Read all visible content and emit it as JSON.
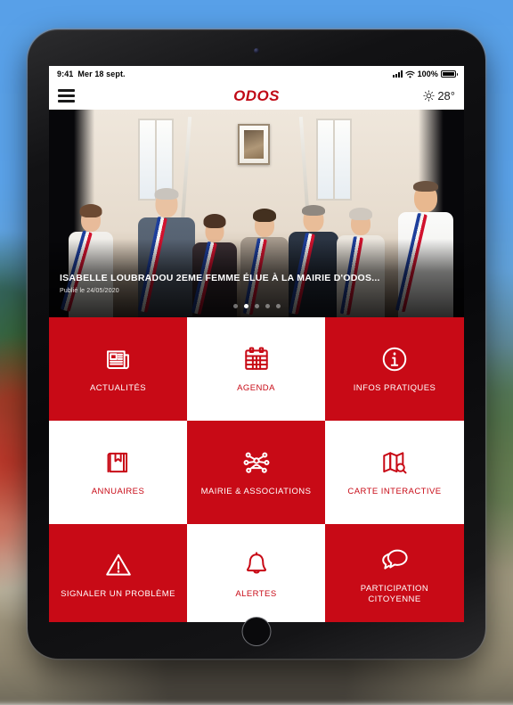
{
  "status_bar": {
    "time": "9:41",
    "date": "Mer 18 sept.",
    "battery_percent": "100%",
    "signal_icon": "cellular-signal-icon",
    "wifi_icon": "wifi-icon",
    "battery_icon": "battery-icon"
  },
  "header": {
    "menu_icon": "hamburger-menu-icon",
    "brand": "ODOS",
    "weather_icon": "sun-icon",
    "temperature": "28°"
  },
  "hero": {
    "title": "ISABELLE LOUBRADOU 2EME FEMME ÉLUE À LA MAIRIE D'ODOS...",
    "date": "Publié le 24/05/2020",
    "slide_count": 5,
    "active_slide": 2,
    "image_description": "Groupe d'élus municipaux portant des écharpes tricolores"
  },
  "tiles": [
    {
      "label": "ACTUALITÉS",
      "icon": "newspaper-icon",
      "style": "red"
    },
    {
      "label": "AGENDA",
      "icon": "calendar-icon",
      "style": "white"
    },
    {
      "label": "INFOS PRATIQUES",
      "icon": "info-circle-icon",
      "style": "red"
    },
    {
      "label": "ANNUAIRES",
      "icon": "book-bookmark-icon",
      "style": "white"
    },
    {
      "label": "MAIRIE & ASSOCIATIONS",
      "icon": "network-people-icon",
      "style": "red"
    },
    {
      "label": "CARTE INTERACTIVE",
      "icon": "map-search-icon",
      "style": "white"
    },
    {
      "label": "SIGNALER UN PROBLÈME",
      "icon": "warning-triangle-icon",
      "style": "red"
    },
    {
      "label": "ALERTES",
      "icon": "bell-icon",
      "style": "white"
    },
    {
      "label": "PARTICIPATION CITOYENNE",
      "icon": "speech-bubbles-icon",
      "style": "red"
    }
  ],
  "device": {
    "frame": "ipad-tablet",
    "home_button_icon": "home-button-icon",
    "camera_icon": "front-camera-icon"
  },
  "colors": {
    "brand_red": "#c80a16",
    "tile_white": "#ffffff",
    "sky_blue": "#58a0e8"
  }
}
